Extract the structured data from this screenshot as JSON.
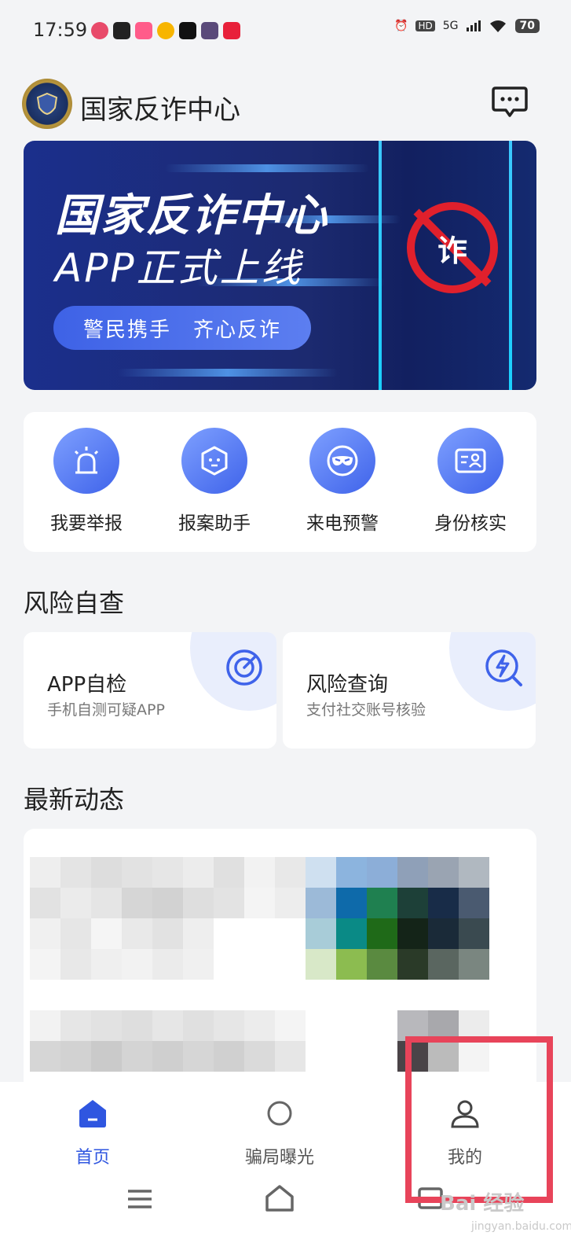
{
  "status_bar": {
    "time": "17:59",
    "network": "5G",
    "hd": "HD",
    "battery": "70",
    "icons": [
      "alarm-icon",
      "hd-icon",
      "signal-icon",
      "wifi-icon",
      "battery-icon"
    ]
  },
  "header": {
    "title": "国家反诈中心",
    "message_icon": "message-icon"
  },
  "banner": {
    "line1": "国家反诈中心",
    "line2": "APP正式上线",
    "slogan": "警民携手　齐心反诈",
    "badge_char": "诈"
  },
  "quick_actions": [
    {
      "label": "我要举报",
      "icon": "alarm-light-icon"
    },
    {
      "label": "报案助手",
      "icon": "robot-face-icon"
    },
    {
      "label": "来电预警",
      "icon": "mask-icon"
    },
    {
      "label": "身份核实",
      "icon": "id-card-icon"
    }
  ],
  "risk_section": {
    "title": "风险自查",
    "cards": [
      {
        "title": "APP自检",
        "subtitle": "手机自测可疑APP",
        "icon": "scan-target-icon"
      },
      {
        "title": "风险查询",
        "subtitle": "支付社交账号核验",
        "icon": "lightning-search-icon"
      }
    ]
  },
  "news_section": {
    "title": "最新动态"
  },
  "bottom_nav": {
    "items": [
      {
        "label": "首页",
        "icon": "home-icon",
        "active": true
      },
      {
        "label": "骗局曝光",
        "icon": "exposure-icon",
        "active": false
      },
      {
        "label": "我的",
        "icon": "profile-icon",
        "active": false
      }
    ]
  },
  "system_nav": {
    "icons": [
      "menu-icon",
      "home-outline-icon",
      "back-icon"
    ]
  },
  "watermark": {
    "brand": "Bai 经验",
    "url": "jingyan.baidu.com"
  },
  "colors": {
    "accent": "#2f56e0",
    "banner_bg": "#1c2a70",
    "highlight": "#e8445a"
  }
}
